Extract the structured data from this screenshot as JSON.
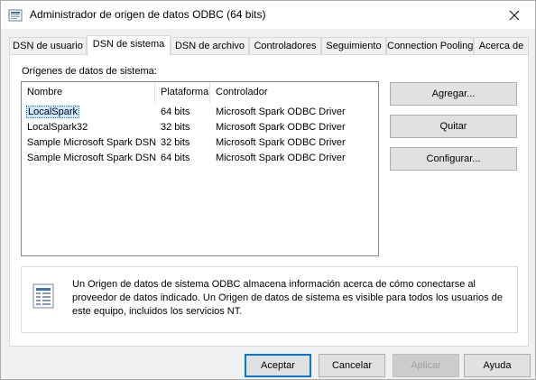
{
  "window": {
    "title": "Administrador de origen de datos ODBC (64 bits)"
  },
  "tabs": [
    {
      "label": "DSN de usuario"
    },
    {
      "label": "DSN de sistema",
      "active": true
    },
    {
      "label": "DSN de archivo"
    },
    {
      "label": "Controladores"
    },
    {
      "label": "Seguimiento"
    },
    {
      "label": "Connection Pooling"
    },
    {
      "label": "Acerca de"
    }
  ],
  "group_label": "Orígenes de datos de sistema:",
  "columns": [
    "Nombre",
    "Plataforma",
    "Controlador"
  ],
  "rows": [
    {
      "name": "LocalSpark",
      "platform": "64 bits",
      "driver": "Microsoft Spark ODBC Driver",
      "selected": true
    },
    {
      "name": "LocalSpark32",
      "platform": "32 bits",
      "driver": "Microsoft Spark ODBC Driver"
    },
    {
      "name": "Sample Microsoft Spark DSN",
      "platform": "32 bits",
      "driver": "Microsoft Spark ODBC Driver"
    },
    {
      "name": "Sample Microsoft Spark DSN",
      "platform": "64 bits",
      "driver": "Microsoft Spark ODBC Driver"
    }
  ],
  "side_buttons": {
    "add": "Agregar...",
    "remove": "Quitar",
    "configure": "Configurar..."
  },
  "info_text": "Un Origen de datos de sistema ODBC almacena información acerca de cómo conectarse al proveedor de datos indicado. Un Origen de datos de sistema es visible para todos los usuarios de este equipo, incluidos los servicios NT.",
  "bottom_buttons": {
    "ok": "Aceptar",
    "cancel": "Cancelar",
    "apply": "Aplicar",
    "help": "Ayuda"
  },
  "colors": {
    "default_button_border": "#0078d7",
    "selection": "#cce8ff"
  }
}
